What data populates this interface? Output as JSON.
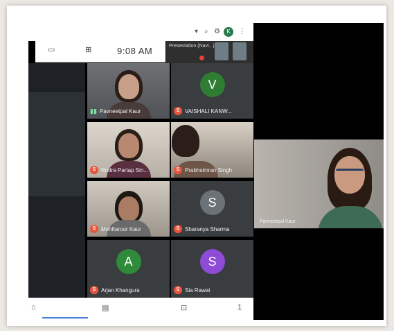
{
  "statusbar": {
    "icons": [
      "wifi-icon",
      "search-icon",
      "settings-icon",
      "more-icon"
    ],
    "avatar_letter": "K"
  },
  "toolbar": {
    "time": "9:08 AM",
    "icons": [
      "captions-icon",
      "people-icon"
    ]
  },
  "presentation_strip": {
    "label": "Presentation (Navi...)"
  },
  "participants": [
    {
      "name": "Pavneetpal Kaur",
      "type": "video",
      "badge": "",
      "mic": "on"
    },
    {
      "name": "VAISHALI KANW...",
      "type": "avatar",
      "letter": "V",
      "color": "#2e7d32",
      "badge": "S"
    },
    {
      "name": "Rudra Partap Sin...",
      "type": "video",
      "badge": "S"
    },
    {
      "name": "Prabhsimran Singh",
      "type": "video",
      "badge": "S"
    },
    {
      "name": "Mehftaroor Kaur",
      "type": "video",
      "badge": "S"
    },
    {
      "name": "Sharanya Sharma",
      "type": "avatar",
      "letter": "S",
      "color": "#6b7378",
      "badge": "S"
    },
    {
      "name": "Arjan Khangura",
      "type": "avatar",
      "letter": "A",
      "color": "#2f8a3a",
      "badge": "S"
    },
    {
      "name": "Sia Rawat",
      "type": "avatar",
      "letter": "S",
      "color": "#8e4bd8",
      "badge": "S"
    }
  ],
  "speaker": {
    "name": "Pavneetpal Kaur"
  },
  "navbar": {
    "icons": [
      "home-icon",
      "grid-icon",
      "present-icon",
      "more-vertical-icon"
    ],
    "page": "1"
  }
}
